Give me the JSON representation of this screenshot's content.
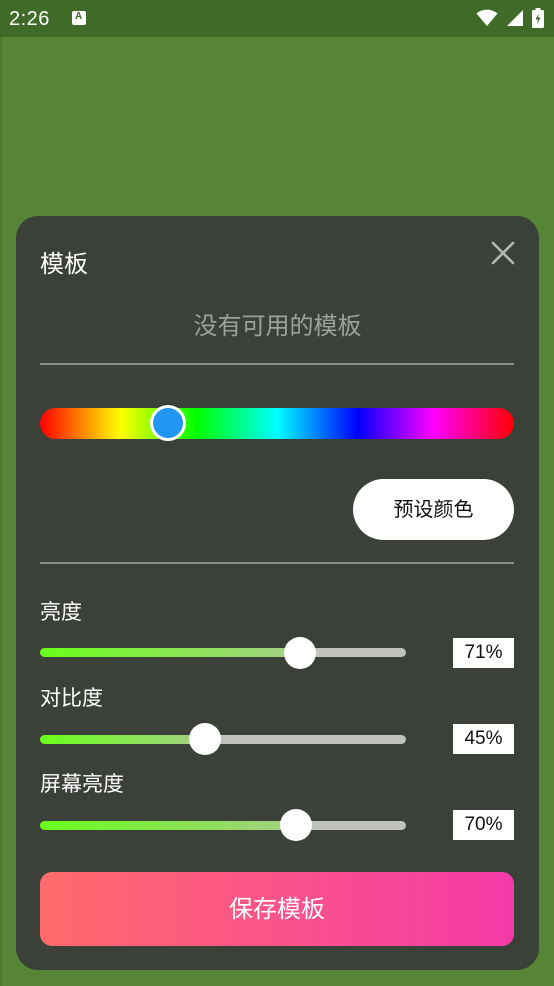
{
  "status_bar": {
    "time": "2:26",
    "icons": [
      "notification-icon",
      "wifi-icon",
      "cellular-signal-icon",
      "battery-charging-icon"
    ]
  },
  "sheet": {
    "title": "模板",
    "empty_message": "没有可用的模板",
    "hue_slider": {
      "selected_color": "#2196f3",
      "position_fraction": 0.27
    },
    "preset_button_label": "预设颜色",
    "sliders": [
      {
        "label": "亮度",
        "value": 71,
        "value_text": "71%"
      },
      {
        "label": "对比度",
        "value": 45,
        "value_text": "45%"
      },
      {
        "label": "屏幕亮度",
        "value": 70,
        "value_text": "70%"
      }
    ],
    "save_button_label": "保存模板"
  },
  "colors": {
    "background": "#558535",
    "sheet": "#3b4039",
    "slider_start": "#6aff1a",
    "save_gradient_start": "#ff6b6b",
    "save_gradient_end": "#f53aa8"
  }
}
